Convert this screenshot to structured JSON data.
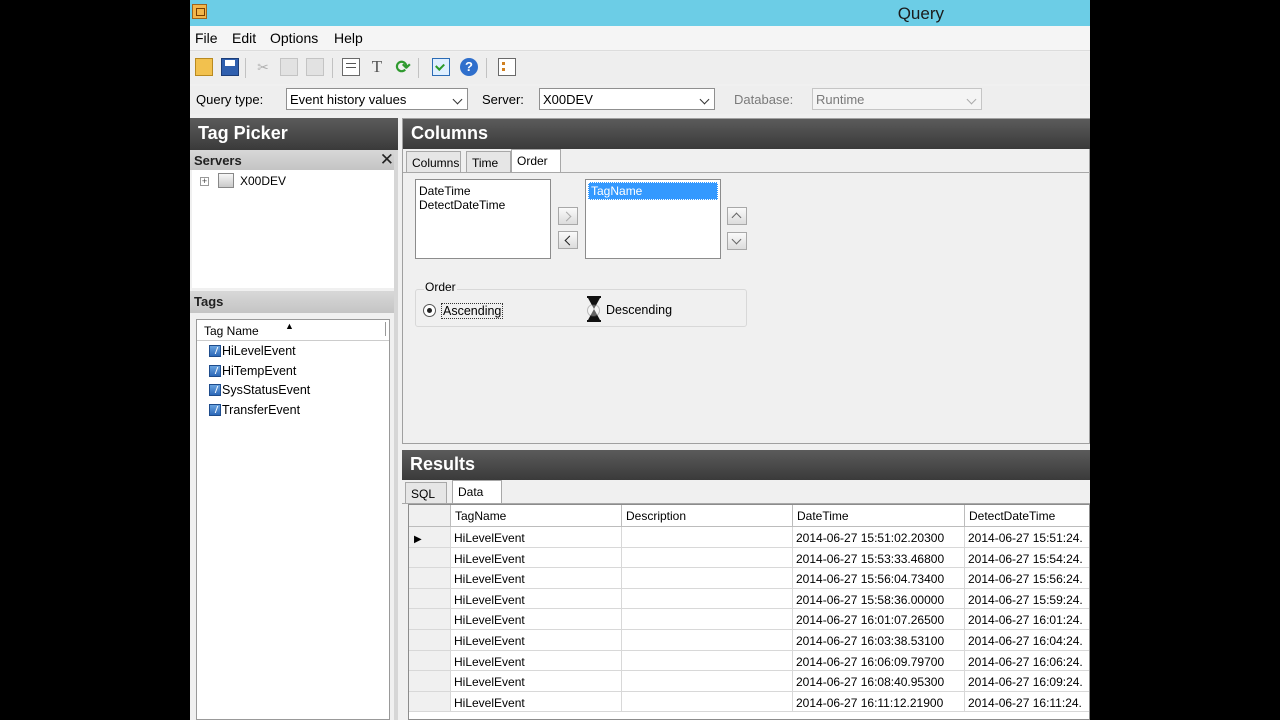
{
  "window": {
    "title": "Query"
  },
  "menu": [
    "File",
    "Edit",
    "Options",
    "Help"
  ],
  "toolbar_icons": [
    "open-icon",
    "save-icon",
    "cut-icon",
    "copy-icon",
    "paste-icon",
    "copy-query-icon",
    "format-icon",
    "refresh-icon",
    "execute-icon",
    "help-icon",
    "options-icon"
  ],
  "query": {
    "type_label": "Query type:",
    "type_value": "Event history values",
    "server_label": "Server:",
    "server_value": "X00DEV",
    "database_label": "Database:",
    "database_value": "Runtime"
  },
  "tag_picker": {
    "title": "Tag Picker",
    "servers_label": "Servers",
    "server_node": "X00DEV",
    "tags_label": "Tags",
    "tag_col": "Tag Name",
    "tags": [
      "HiLevelEvent",
      "HiTempEvent",
      "SysStatusEvent",
      "TransferEvent"
    ]
  },
  "columns": {
    "title": "Columns",
    "tabs": [
      "Columns",
      "Time",
      "Order"
    ],
    "available": [
      "DateTime",
      "DetectDateTime"
    ],
    "selected": [
      "TagName"
    ],
    "order_label": "Order",
    "ascending": "Ascending",
    "descending": "Descending"
  },
  "results": {
    "title": "Results",
    "tabs": [
      "SQL",
      "Data"
    ],
    "headers": [
      "TagName",
      "Description",
      "DateTime",
      "DetectDateTime"
    ],
    "rows": [
      [
        "HiLevelEvent",
        "",
        "2014-06-27 15:51:02.20300",
        "2014-06-27 15:51:24."
      ],
      [
        "HiLevelEvent",
        "",
        "2014-06-27 15:53:33.46800",
        "2014-06-27 15:54:24."
      ],
      [
        "HiLevelEvent",
        "",
        "2014-06-27 15:56:04.73400",
        "2014-06-27 15:56:24."
      ],
      [
        "HiLevelEvent",
        "",
        "2014-06-27 15:58:36.00000",
        "2014-06-27 15:59:24."
      ],
      [
        "HiLevelEvent",
        "",
        "2014-06-27 16:01:07.26500",
        "2014-06-27 16:01:24."
      ],
      [
        "HiLevelEvent",
        "",
        "2014-06-27 16:03:38.53100",
        "2014-06-27 16:04:24."
      ],
      [
        "HiLevelEvent",
        "",
        "2014-06-27 16:06:09.79700",
        "2014-06-27 16:06:24."
      ],
      [
        "HiLevelEvent",
        "",
        "2014-06-27 16:08:40.95300",
        "2014-06-27 16:09:24."
      ],
      [
        "HiLevelEvent",
        "",
        "2014-06-27 16:11:12.21900",
        "2014-06-27 16:11:24."
      ]
    ]
  },
  "colors": {
    "titlebar": "#6ccde6",
    "panel_header": "#474747",
    "selection": "#3399ff"
  }
}
